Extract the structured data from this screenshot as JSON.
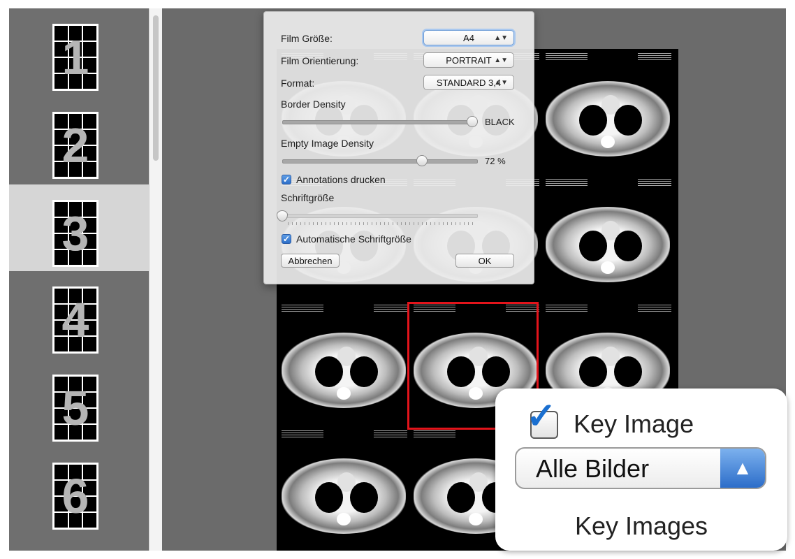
{
  "sidebar": {
    "layouts": [
      {
        "number": "1"
      },
      {
        "number": "2"
      },
      {
        "number": "3",
        "selected": true
      },
      {
        "number": "4"
      },
      {
        "number": "5"
      },
      {
        "number": "6"
      }
    ]
  },
  "dialog": {
    "film_size": {
      "label": "Film Größe:",
      "value": "A4"
    },
    "film_orientation": {
      "label": "Film Orientierung:",
      "value": "PORTRAIT"
    },
    "format": {
      "label": "Format:",
      "value": "STANDARD 3,4"
    },
    "border_density": {
      "label": "Border Density",
      "value": "BLACK",
      "level": 1.0
    },
    "empty_image_density": {
      "label": "Empty Image Density",
      "value": "72 %",
      "level": 0.72
    },
    "print_annotations": {
      "label": "Annotations drucken",
      "checked": true
    },
    "font_size": {
      "label": "Schriftgröße",
      "level": 0.0
    },
    "auto_font_size": {
      "label": "Automatische Schriftgröße",
      "checked": true
    },
    "cancel_label": "Abbrechen",
    "ok_label": "OK"
  },
  "zoom": {
    "key_image_label": "Key Image",
    "key_image_checked": true,
    "filter_value": "Alle Bilder",
    "caption": "Key Images"
  },
  "colors": {
    "selection_frame": "#e3141b",
    "checkbox_accent": "#2c6ec8"
  }
}
